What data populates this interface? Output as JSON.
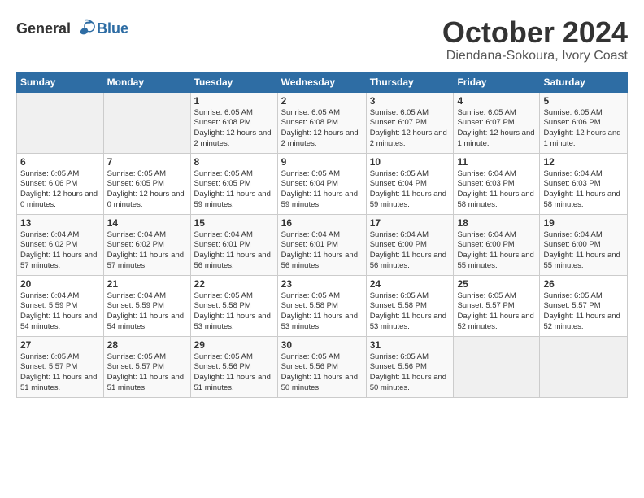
{
  "logo": {
    "text_general": "General",
    "text_blue": "Blue"
  },
  "header": {
    "month": "October 2024",
    "location": "Diendana-Sokoura, Ivory Coast"
  },
  "weekdays": [
    "Sunday",
    "Monday",
    "Tuesday",
    "Wednesday",
    "Thursday",
    "Friday",
    "Saturday"
  ],
  "weeks": [
    [
      {
        "day": "",
        "info": ""
      },
      {
        "day": "",
        "info": ""
      },
      {
        "day": "1",
        "info": "Sunrise: 6:05 AM\nSunset: 6:08 PM\nDaylight: 12 hours\nand 2 minutes."
      },
      {
        "day": "2",
        "info": "Sunrise: 6:05 AM\nSunset: 6:08 PM\nDaylight: 12 hours\nand 2 minutes."
      },
      {
        "day": "3",
        "info": "Sunrise: 6:05 AM\nSunset: 6:07 PM\nDaylight: 12 hours\nand 2 minutes."
      },
      {
        "day": "4",
        "info": "Sunrise: 6:05 AM\nSunset: 6:07 PM\nDaylight: 12 hours\nand 1 minute."
      },
      {
        "day": "5",
        "info": "Sunrise: 6:05 AM\nSunset: 6:06 PM\nDaylight: 12 hours\nand 1 minute."
      }
    ],
    [
      {
        "day": "6",
        "info": "Sunrise: 6:05 AM\nSunset: 6:06 PM\nDaylight: 12 hours\nand 0 minutes."
      },
      {
        "day": "7",
        "info": "Sunrise: 6:05 AM\nSunset: 6:05 PM\nDaylight: 12 hours\nand 0 minutes."
      },
      {
        "day": "8",
        "info": "Sunrise: 6:05 AM\nSunset: 6:05 PM\nDaylight: 11 hours\nand 59 minutes."
      },
      {
        "day": "9",
        "info": "Sunrise: 6:05 AM\nSunset: 6:04 PM\nDaylight: 11 hours\nand 59 minutes."
      },
      {
        "day": "10",
        "info": "Sunrise: 6:05 AM\nSunset: 6:04 PM\nDaylight: 11 hours\nand 59 minutes."
      },
      {
        "day": "11",
        "info": "Sunrise: 6:04 AM\nSunset: 6:03 PM\nDaylight: 11 hours\nand 58 minutes."
      },
      {
        "day": "12",
        "info": "Sunrise: 6:04 AM\nSunset: 6:03 PM\nDaylight: 11 hours\nand 58 minutes."
      }
    ],
    [
      {
        "day": "13",
        "info": "Sunrise: 6:04 AM\nSunset: 6:02 PM\nDaylight: 11 hours\nand 57 minutes."
      },
      {
        "day": "14",
        "info": "Sunrise: 6:04 AM\nSunset: 6:02 PM\nDaylight: 11 hours\nand 57 minutes."
      },
      {
        "day": "15",
        "info": "Sunrise: 6:04 AM\nSunset: 6:01 PM\nDaylight: 11 hours\nand 56 minutes."
      },
      {
        "day": "16",
        "info": "Sunrise: 6:04 AM\nSunset: 6:01 PM\nDaylight: 11 hours\nand 56 minutes."
      },
      {
        "day": "17",
        "info": "Sunrise: 6:04 AM\nSunset: 6:00 PM\nDaylight: 11 hours\nand 56 minutes."
      },
      {
        "day": "18",
        "info": "Sunrise: 6:04 AM\nSunset: 6:00 PM\nDaylight: 11 hours\nand 55 minutes."
      },
      {
        "day": "19",
        "info": "Sunrise: 6:04 AM\nSunset: 6:00 PM\nDaylight: 11 hours\nand 55 minutes."
      }
    ],
    [
      {
        "day": "20",
        "info": "Sunrise: 6:04 AM\nSunset: 5:59 PM\nDaylight: 11 hours\nand 54 minutes."
      },
      {
        "day": "21",
        "info": "Sunrise: 6:04 AM\nSunset: 5:59 PM\nDaylight: 11 hours\nand 54 minutes."
      },
      {
        "day": "22",
        "info": "Sunrise: 6:05 AM\nSunset: 5:58 PM\nDaylight: 11 hours\nand 53 minutes."
      },
      {
        "day": "23",
        "info": "Sunrise: 6:05 AM\nSunset: 5:58 PM\nDaylight: 11 hours\nand 53 minutes."
      },
      {
        "day": "24",
        "info": "Sunrise: 6:05 AM\nSunset: 5:58 PM\nDaylight: 11 hours\nand 53 minutes."
      },
      {
        "day": "25",
        "info": "Sunrise: 6:05 AM\nSunset: 5:57 PM\nDaylight: 11 hours\nand 52 minutes."
      },
      {
        "day": "26",
        "info": "Sunrise: 6:05 AM\nSunset: 5:57 PM\nDaylight: 11 hours\nand 52 minutes."
      }
    ],
    [
      {
        "day": "27",
        "info": "Sunrise: 6:05 AM\nSunset: 5:57 PM\nDaylight: 11 hours\nand 51 minutes."
      },
      {
        "day": "28",
        "info": "Sunrise: 6:05 AM\nSunset: 5:57 PM\nDaylight: 11 hours\nand 51 minutes."
      },
      {
        "day": "29",
        "info": "Sunrise: 6:05 AM\nSunset: 5:56 PM\nDaylight: 11 hours\nand 51 minutes."
      },
      {
        "day": "30",
        "info": "Sunrise: 6:05 AM\nSunset: 5:56 PM\nDaylight: 11 hours\nand 50 minutes."
      },
      {
        "day": "31",
        "info": "Sunrise: 6:05 AM\nSunset: 5:56 PM\nDaylight: 11 hours\nand 50 minutes."
      },
      {
        "day": "",
        "info": ""
      },
      {
        "day": "",
        "info": ""
      }
    ]
  ]
}
